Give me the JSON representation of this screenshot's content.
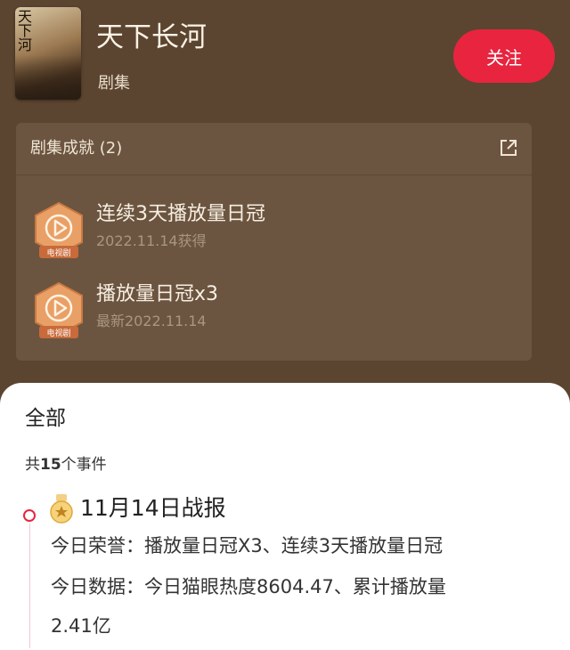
{
  "header": {
    "poster_alt": "天下长河",
    "title": "天下长河",
    "subtitle": "剧集",
    "follow_label": "关注"
  },
  "achievements": {
    "title": "剧集成就 (2)",
    "items": [
      {
        "name": "连续3天播放量日冠",
        "date": "2022.11.14获得",
        "badge_tag": "电视剧"
      },
      {
        "name": "播放量日冠x3",
        "date": "最新2022.11.14",
        "badge_tag": "电视剧"
      }
    ]
  },
  "events": {
    "tab_label": "全部",
    "count_prefix": "共",
    "count_value": "15",
    "count_suffix": "个事件",
    "items": [
      {
        "title": "11月14日战报",
        "line1": "今日荣誉：播放量日冠X3、连续3天播放量日冠",
        "line2": "今日数据：今日猫眼热度8604.47、累计播放量",
        "line3": "2.41亿"
      }
    ]
  },
  "colors": {
    "background": "#5b4530",
    "card": "#6b5540",
    "accent": "#e8243f",
    "badge": "#e9a066"
  }
}
